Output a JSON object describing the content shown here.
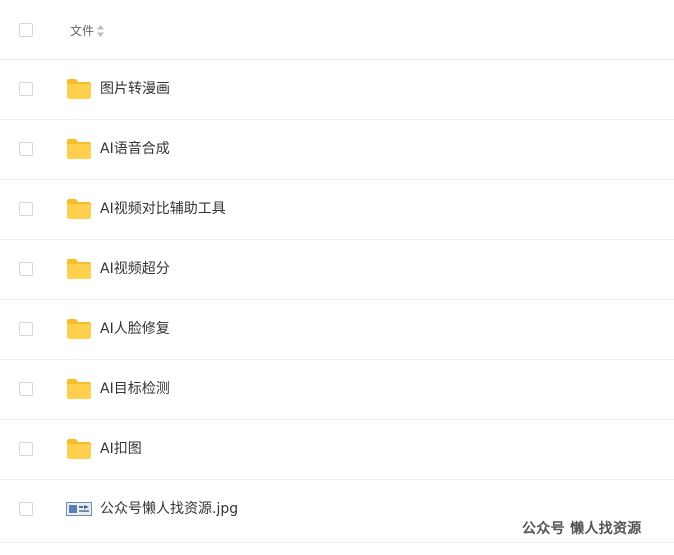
{
  "header": {
    "column_file_label": "文件"
  },
  "rows": [
    {
      "name": "图片转漫画",
      "type": "folder"
    },
    {
      "name": "AI语音合成",
      "type": "folder"
    },
    {
      "name": "AI视频对比辅助工具",
      "type": "folder"
    },
    {
      "name": "AI视频超分",
      "type": "folder"
    },
    {
      "name": "AI人脸修复",
      "type": "folder"
    },
    {
      "name": "AI目标检测",
      "type": "folder"
    },
    {
      "name": "AI扣图",
      "type": "folder"
    },
    {
      "name": "公众号懒人找资源.jpg",
      "type": "image"
    }
  ],
  "watermark": {
    "text": "公众号  懒人找资源"
  },
  "colors": {
    "folder_main": "#FFD04D",
    "folder_tab": "#F7BC2A",
    "checkbox_border": "#D6D6D6",
    "row_divider": "#F0F0F0"
  },
  "icons": {
    "folder": "folder-icon",
    "image_file": "image-file-icon",
    "sort": "sort-icon"
  }
}
